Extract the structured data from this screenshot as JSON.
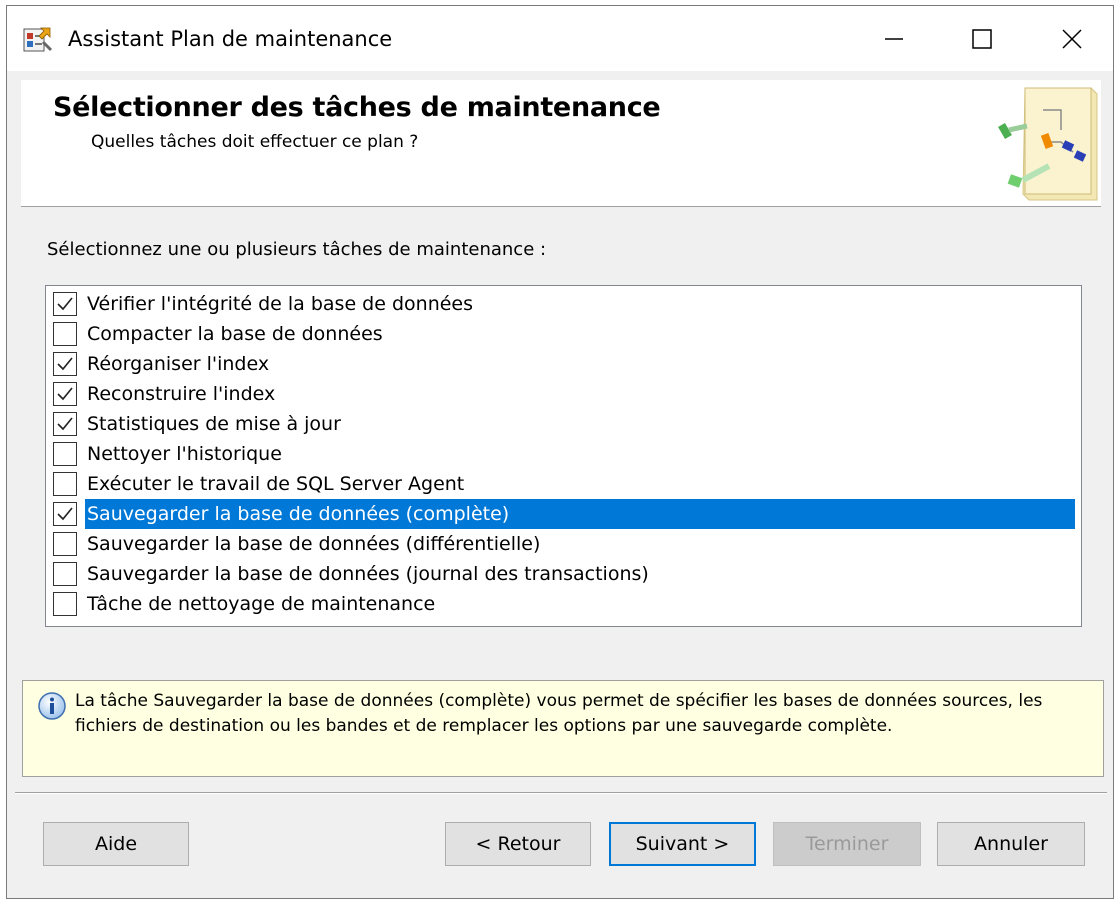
{
  "window": {
    "title": "Assistant Plan de maintenance"
  },
  "header": {
    "title": "Sélectionner des tâches de maintenance",
    "subtitle": "Quelles tâches doit effectuer ce plan ?"
  },
  "task_section": {
    "label": "Sélectionnez une ou plusieurs tâches de maintenance :"
  },
  "tasks": [
    {
      "label": "Vérifier l'intégrité de la base de données",
      "checked": true,
      "selected": false
    },
    {
      "label": "Compacter la base de données",
      "checked": false,
      "selected": false
    },
    {
      "label": "Réorganiser l'index",
      "checked": true,
      "selected": false
    },
    {
      "label": "Reconstruire l'index",
      "checked": true,
      "selected": false
    },
    {
      "label": "Statistiques de mise à jour",
      "checked": true,
      "selected": false
    },
    {
      "label": "Nettoyer l'historique",
      "checked": false,
      "selected": false
    },
    {
      "label": "Exécuter le travail de SQL Server Agent",
      "checked": false,
      "selected": false
    },
    {
      "label": "Sauvegarder la base de données (complète)",
      "checked": true,
      "selected": true
    },
    {
      "label": "Sauvegarder la base de données (différentielle)",
      "checked": false,
      "selected": false
    },
    {
      "label": "Sauvegarder la base de données (journal des transactions)",
      "checked": false,
      "selected": false
    },
    {
      "label": "Tâche de nettoyage de maintenance",
      "checked": false,
      "selected": false
    }
  ],
  "info": {
    "icon": "info-icon",
    "text": "La tâche Sauvegarder la base de données (complète) vous permet de spécifier les bases de données sources, les fichiers de destination ou les bandes et de remplacer les options par une sauvegarde complète."
  },
  "buttons": {
    "help": "Aide",
    "back": "< Retour",
    "next": "Suivant >",
    "finish": "Terminer",
    "cancel": "Annuler"
  },
  "colors": {
    "selection": "#0078d7",
    "info_background": "#ffffe1",
    "dialog_background": "#f0f0f0"
  }
}
